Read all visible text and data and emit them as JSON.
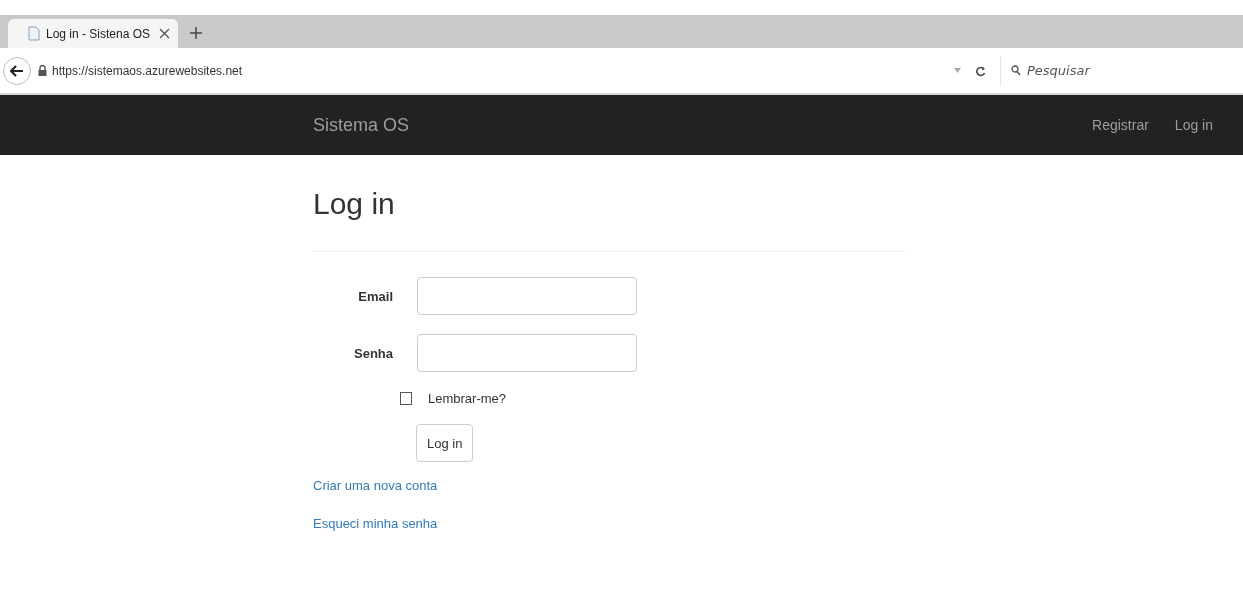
{
  "browser": {
    "tab_title": "Log in - Sistena OS",
    "url": "https://sistemaos.azurewebsites.net",
    "search_placeholder": "Pesquisar"
  },
  "navbar": {
    "brand": "Sistema OS",
    "links": [
      "Registrar",
      "Log in"
    ]
  },
  "heading": "Log in",
  "fields": [
    {
      "label": "Email"
    },
    {
      "label": "Senha"
    }
  ],
  "remember": {
    "label": "Lembrar-me?",
    "checked": false
  },
  "submit": "Log in",
  "links": [
    "Criar uma nova conta",
    "Esqueci minha senha"
  ]
}
